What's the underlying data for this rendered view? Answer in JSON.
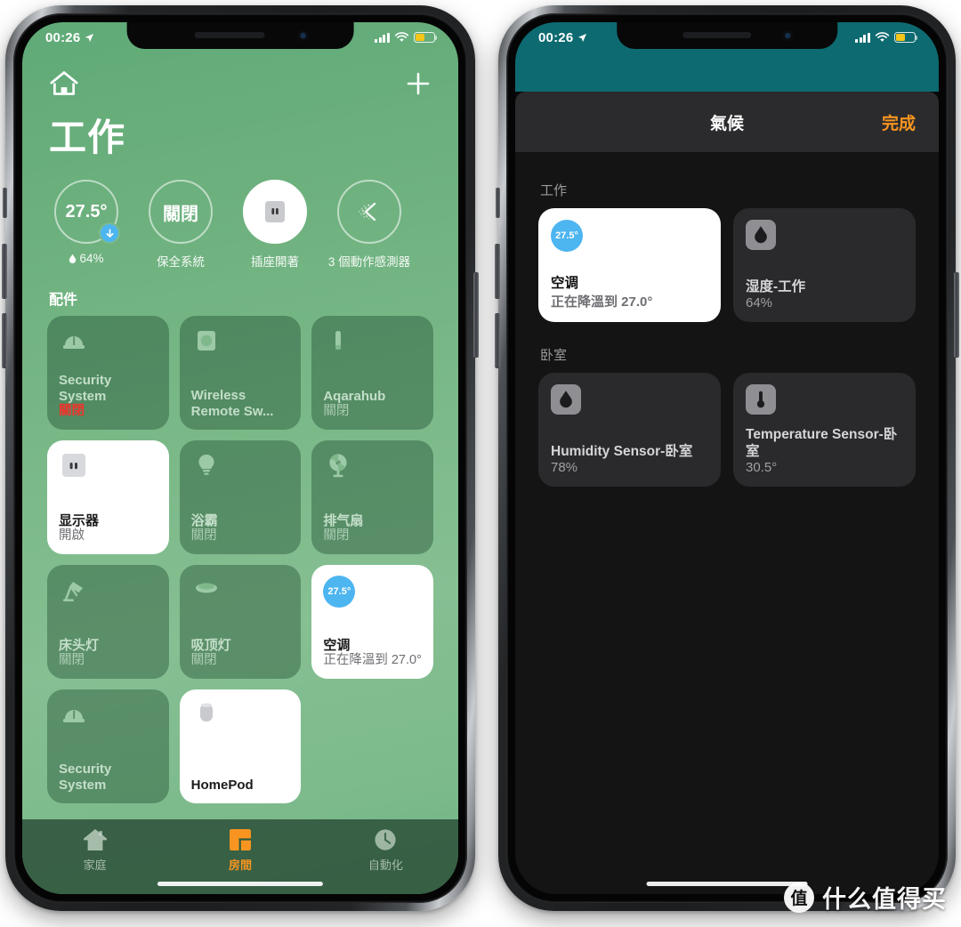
{
  "watermark": {
    "badge": "值",
    "text": "什么值得买"
  },
  "left_phone": {
    "status_bar": {
      "time": "00:26",
      "location_icon": "location-arrow-icon",
      "signal_icon": "cellular-bars-icon",
      "wifi_icon": "wifi-icon",
      "battery_icon": "battery-icon"
    },
    "top_bar": {
      "home_icon": "house-icon",
      "add_icon": "plus-icon"
    },
    "room_title": "工作",
    "status_circles": [
      {
        "value": "27.5°",
        "caption": "64%",
        "caption_icon": "humidity-drop-icon",
        "badge_icon": "arrow-down-icon",
        "state": "outline"
      },
      {
        "value": "關閉",
        "caption": "保全系統",
        "state": "outline"
      },
      {
        "value": "",
        "caption": "插座開著",
        "icon": "outlet-icon",
        "state": "filled"
      },
      {
        "value": "",
        "caption": "3 個動作感測器",
        "icon": "motion-sensor-icon",
        "state": "outline"
      }
    ],
    "accessories_header": "配件",
    "tiles": [
      {
        "name": "Security System",
        "state": "關閉",
        "icon": "alarm-siren-icon",
        "on": false,
        "alert": true
      },
      {
        "name": "Wireless Remote Sw...",
        "state": "",
        "icon": "remote-switch-icon",
        "on": false,
        "alert": false
      },
      {
        "name": "Aqarahub",
        "state": "關閉",
        "icon": "hub-icon",
        "on": false,
        "alert": false
      },
      {
        "name": "显示器",
        "state": "開啟",
        "icon": "outlet-icon",
        "on": true,
        "alert": false
      },
      {
        "name": "浴霸",
        "state": "關閉",
        "icon": "bulb-icon",
        "on": false,
        "alert": false
      },
      {
        "name": "排气扇",
        "state": "關閉",
        "icon": "fan-icon",
        "on": false,
        "alert": false
      },
      {
        "name": "床头灯",
        "state": "關閉",
        "icon": "desk-lamp-icon",
        "on": false,
        "alert": false
      },
      {
        "name": "吸顶灯",
        "state": "關閉",
        "icon": "ceiling-light-icon",
        "on": false,
        "alert": false
      },
      {
        "name": "空调",
        "state": "正在降溫到 27.0°",
        "icon": "thermostat-bubble-icon",
        "bubble": "27.5°",
        "on": true,
        "alert": false
      },
      {
        "name": "Security System",
        "state": "",
        "icon": "alarm-siren-icon",
        "on": false,
        "alert": false
      },
      {
        "name": "HomePod",
        "state": "",
        "icon": "homepod-icon",
        "on": true,
        "alert": false
      }
    ],
    "tabs": [
      {
        "label": "家庭",
        "icon": "house-filled-icon",
        "active": false
      },
      {
        "label": "房間",
        "icon": "rooms-icon",
        "active": true
      },
      {
        "label": "自動化",
        "icon": "clock-icon",
        "active": false
      }
    ]
  },
  "right_phone": {
    "status_bar": {
      "time": "00:26",
      "location_icon": "location-arrow-icon",
      "signal_icon": "cellular-bars-icon",
      "wifi_icon": "wifi-icon",
      "battery_icon": "battery-icon"
    },
    "nav": {
      "title": "氣候",
      "done": "完成"
    },
    "sections": [
      {
        "header": "工作",
        "tiles": [
          {
            "name": "空调",
            "state": "正在降溫到 27.0°",
            "bubble": "27.5°",
            "icon": "thermostat-bubble-icon",
            "on": true
          },
          {
            "name": "湿度-工作",
            "state": "64%",
            "icon": "humidity-drop-icon",
            "on": false
          }
        ]
      },
      {
        "header": "卧室",
        "tiles": [
          {
            "name": "Humidity Sensor-卧室",
            "state": "78%",
            "icon": "humidity-drop-icon",
            "on": false
          },
          {
            "name": "Temperature Sensor-卧室",
            "state": "30.5°",
            "icon": "thermometer-icon",
            "on": false
          }
        ]
      }
    ]
  }
}
